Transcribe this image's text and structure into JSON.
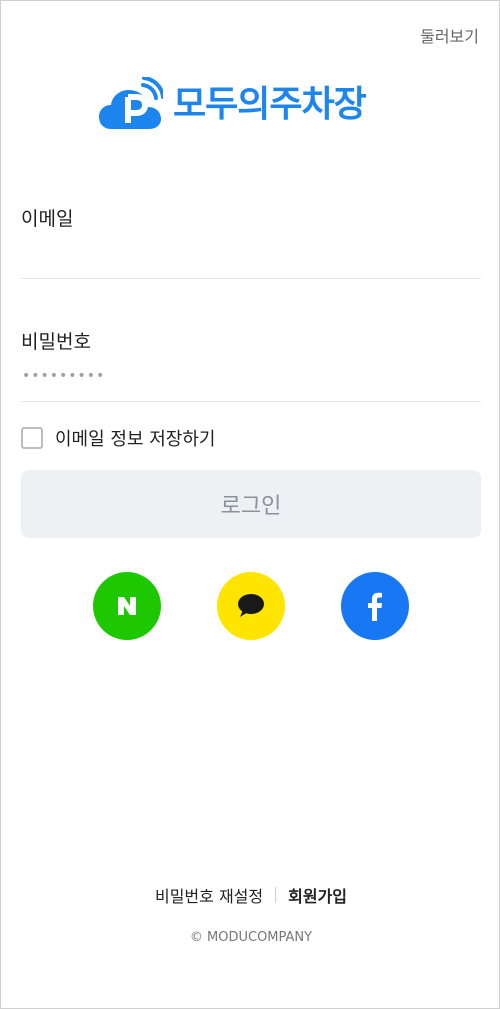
{
  "header": {
    "browse_label": "둘러보기"
  },
  "logo": {
    "text": "모두의주차장",
    "brand_color": "#1c86ee"
  },
  "form": {
    "email": {
      "label": "이메일",
      "value": "",
      "placeholder": ""
    },
    "password": {
      "label": "비밀번호",
      "masked_value": "•••••••••"
    },
    "save_email": {
      "label": "이메일 정보 저장하기",
      "checked": false
    },
    "login_button": "로그인"
  },
  "social": [
    {
      "name": "naver",
      "icon": "naver-n-icon",
      "color": "#1ec800"
    },
    {
      "name": "kakao",
      "icon": "speech-bubble-icon",
      "color": "#fee500"
    },
    {
      "name": "facebook",
      "icon": "facebook-f-icon",
      "color": "#1877f2"
    }
  ],
  "footer": {
    "reset_password": "비밀번호 재설정",
    "signup": "회원가입",
    "copyright": "© MODUCOMPANY"
  }
}
